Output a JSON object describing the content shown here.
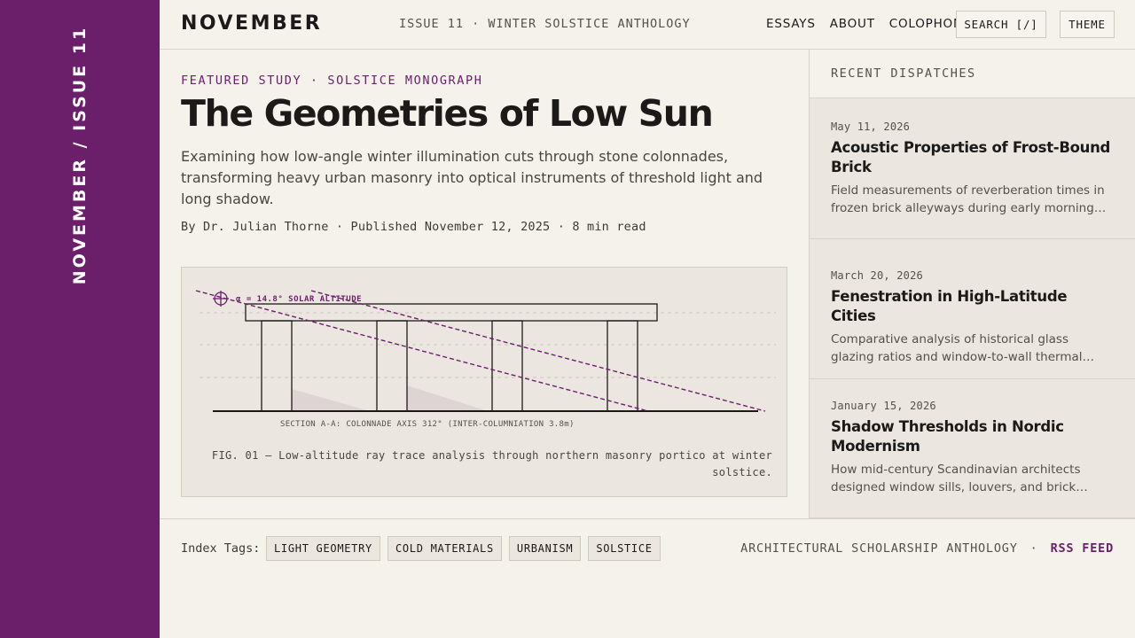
{
  "band": {
    "label": "NOVEMBER / ISSUE 11"
  },
  "header": {
    "brand": "NOVEMBER",
    "issue": "ISSUE 11 · WINTER SOLSTICE ANTHOLOGY",
    "nav": [
      "ESSAYS",
      "ABOUT",
      "COLOPHON"
    ],
    "search_label": "SEARCH [/]",
    "theme_label": "THEME"
  },
  "article": {
    "kicker": "FEATURED STUDY · SOLSTICE MONOGRAPH",
    "title": "The Geometries of Low Sun",
    "dek": "Examining how low-angle winter illumination cuts through stone colonnades, transforming heavy urban masonry into optical instruments of threshold light and long shadow.",
    "byline": "By Dr. Julian Thorne · Published November 12, 2025 · 8 min read",
    "figure": {
      "sun_label": "α = 14.8° SOLAR ALTITUDE",
      "section_label": "SECTION A-A: COLONNADE AXIS 312° (INTER-COLUMNIATION 3.8m)",
      "caption": "FIG. 01 — Low-altitude ray trace analysis through northern masonry portico at winter solstice."
    }
  },
  "sidebar": {
    "heading": "RECENT DISPATCHES",
    "items": [
      {
        "date": "May 11, 2026",
        "title": "Acoustic Properties of Frost-Bound Brick",
        "desc": "Field measurements of reverberation times in frozen brick alleyways during early morning frost..."
      },
      {
        "date": "March 20, 2026",
        "title": "Fenestration in High-Latitude Cities",
        "desc": "Comparative analysis of historical glass glazing ratios and window-to-wall thermal ratios across..."
      },
      {
        "date": "January 15, 2026",
        "title": "Shadow Thresholds in Nordic Modernism",
        "desc": "How mid-century Scandinavian architects designed window sills, louvers, and brick soffits to..."
      }
    ]
  },
  "footer": {
    "tags_label": "Index Tags:",
    "tags": [
      "LIGHT GEOMETRY",
      "COLD MATERIALS",
      "URBANISM",
      "SOLSTICE"
    ],
    "anthology": "ARCHITECTURAL SCHOLARSHIP ANTHOLOGY",
    "separator": "·",
    "rss": "RSS FEED"
  },
  "colors": {
    "accent": "#6b1f6b",
    "paper": "#f5f2ec",
    "panel": "#ebe6df",
    "ink": "#1c1a19"
  }
}
